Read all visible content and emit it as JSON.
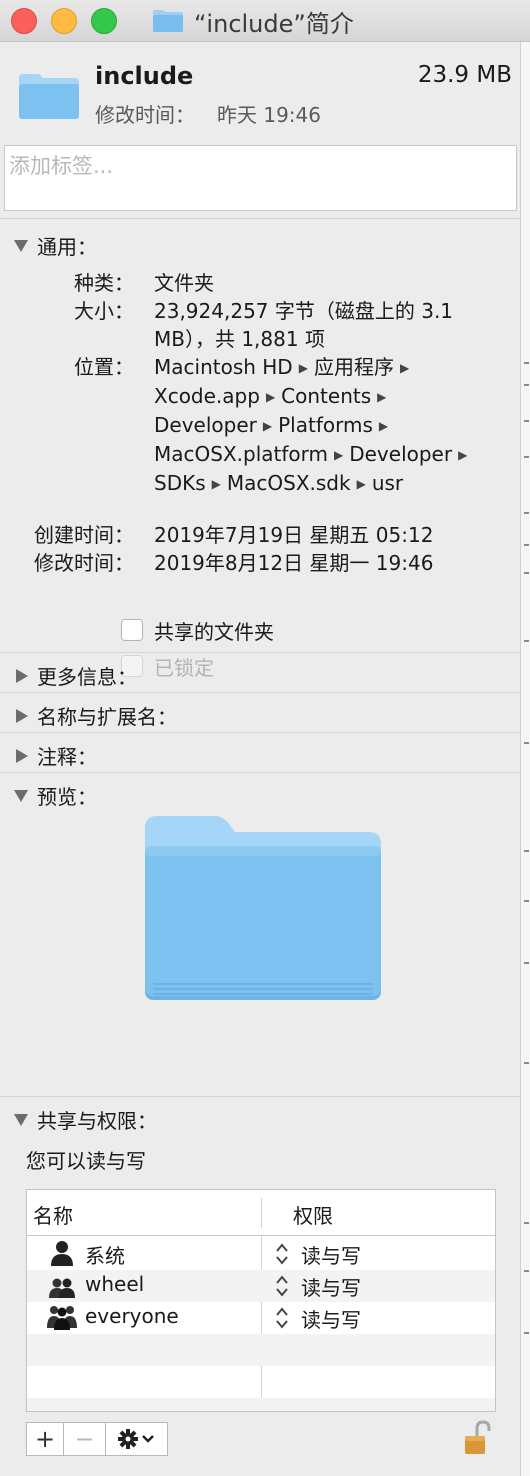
{
  "window": {
    "title": "“include”简介"
  },
  "header": {
    "name": "include",
    "size": "23.9 MB",
    "modified_label": "修改时间：",
    "modified_value": "昨天 19:46"
  },
  "tags": {
    "placeholder": "添加标签..."
  },
  "general": {
    "title": "通用：",
    "kind_label": "种类：",
    "kind_value": "文件夹",
    "size_label": "大小：",
    "size_line1": "23,924,257 字节（磁盘上的 3.1",
    "size_line2": "MB），共 1,881 项",
    "where_label": "位置：",
    "path": [
      "Macintosh HD",
      "应用程序",
      "Xcode.app",
      "Contents",
      "Developer",
      "Platforms",
      "MacOSX.platform",
      "Developer",
      "SDKs",
      "MacOSX.sdk",
      "usr"
    ],
    "created_label": "创建时间：",
    "created_value": "2019年7月19日 星期五 05:12",
    "modified_label": "修改时间：",
    "modified_value": "2019年8月12日 星期一 19:46",
    "shared_folder_label": "共享的文件夹",
    "locked_label": "已锁定"
  },
  "sections": {
    "more_info": "更多信息：",
    "name_ext": "名称与扩展名：",
    "comments": "注释：",
    "preview": "预览："
  },
  "permissions": {
    "title": "共享与权限：",
    "summary": "您可以读与写",
    "col_name": "名称",
    "col_privilege": "权限",
    "rows": [
      {
        "name": "系统",
        "privilege": "读与写",
        "icon": "single-user-icon"
      },
      {
        "name": "wheel",
        "privilege": "读与写",
        "icon": "group-icon"
      },
      {
        "name": "everyone",
        "privilege": "读与写",
        "icon": "everyone-icon"
      }
    ],
    "add_label": "+",
    "remove_label": "−"
  },
  "colors": {
    "folder_blue": "#7cc1ef",
    "folder_tab": "#a6d6f7"
  }
}
